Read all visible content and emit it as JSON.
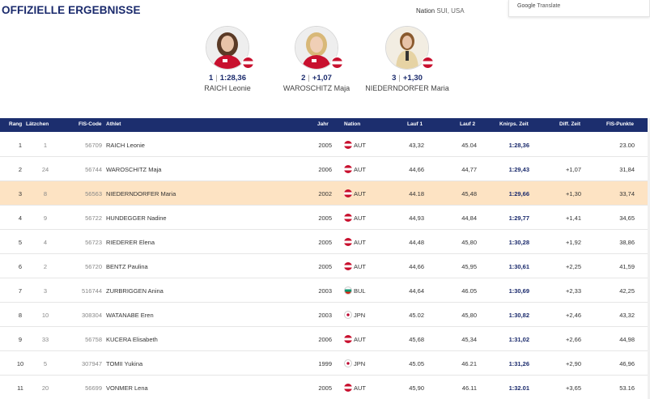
{
  "page": {
    "title": "OFFIZIELLE ERGEBNISSE"
  },
  "filter": {
    "label": "Nation",
    "value": "SUI, USA"
  },
  "translate": {
    "google": "Google",
    "label": "Translate"
  },
  "podium": [
    {
      "rank": "1",
      "time": "1:28,36",
      "name": "RAICH Leonie",
      "nation": "AUT"
    },
    {
      "rank": "2",
      "time": "+1,07",
      "name": "WAROSCHITZ Maja",
      "nation": "AUT"
    },
    {
      "rank": "3",
      "time": "+1,30",
      "name": "NIEDERNDORFER Maria",
      "nation": "AUT"
    }
  ],
  "table": {
    "headers": {
      "rang": "Rang",
      "latz": "Lätzchen",
      "fis": "FIS-Code",
      "athlet": "Athlet",
      "jahr": "Jahr",
      "nation": "Nation",
      "lauf1": "Lauf 1",
      "lauf2": "Lauf 2",
      "total": "Knirps. Zeit",
      "diff": "Diff. Zeit",
      "punkte": "FIS-Punkte"
    },
    "rows": [
      {
        "rang": "1",
        "latz": "1",
        "fis": "56709",
        "athlet": "RAICH Leonie",
        "jahr": "2005",
        "nation": "AUT",
        "lauf1": "43,32",
        "lauf2": "45.04",
        "total": "1:28,36",
        "diff": "",
        "punkte": "23.00"
      },
      {
        "rang": "2",
        "latz": "24",
        "fis": "56744",
        "athlet": "WAROSCHITZ Maja",
        "jahr": "2006",
        "nation": "AUT",
        "lauf1": "44,66",
        "lauf2": "44,77",
        "total": "1:29,43",
        "diff": "+1,07",
        "punkte": "31,84"
      },
      {
        "rang": "3",
        "latz": "8",
        "fis": "56563",
        "athlet": "NIEDERNDORFER Maria",
        "jahr": "2002",
        "nation": "AUT",
        "lauf1": "44.18",
        "lauf2": "45,48",
        "total": "1:29,66",
        "diff": "+1,30",
        "punkte": "33,74"
      },
      {
        "rang": "4",
        "latz": "9",
        "fis": "56722",
        "athlet": "HUNDEGGER Nadine",
        "jahr": "2005",
        "nation": "AUT",
        "lauf1": "44,93",
        "lauf2": "44,84",
        "total": "1:29,77",
        "diff": "+1,41",
        "punkte": "34,65"
      },
      {
        "rang": "5",
        "latz": "4",
        "fis": "56723",
        "athlet": "RIEDERER Elena",
        "jahr": "2005",
        "nation": "AUT",
        "lauf1": "44,48",
        "lauf2": "45,80",
        "total": "1:30,28",
        "diff": "+1,92",
        "punkte": "38,86"
      },
      {
        "rang": "6",
        "latz": "2",
        "fis": "56720",
        "athlet": "BENTZ Paulina",
        "jahr": "2005",
        "nation": "AUT",
        "lauf1": "44,66",
        "lauf2": "45,95",
        "total": "1:30,61",
        "diff": "+2,25",
        "punkte": "41,59"
      },
      {
        "rang": "7",
        "latz": "3",
        "fis": "516744",
        "athlet": "ZURBRIGGEN Anina",
        "jahr": "2003",
        "nation": "BUL",
        "lauf1": "44,64",
        "lauf2": "46.05",
        "total": "1:30,69",
        "diff": "+2,33",
        "punkte": "42,25"
      },
      {
        "rang": "8",
        "latz": "10",
        "fis": "308304",
        "athlet": "WATANABE Eren",
        "jahr": "2003",
        "nation": "JPN",
        "lauf1": "45.02",
        "lauf2": "45,80",
        "total": "1:30,82",
        "diff": "+2,46",
        "punkte": "43,32"
      },
      {
        "rang": "9",
        "latz": "33",
        "fis": "56758",
        "athlet": "KUCERA Elisabeth",
        "jahr": "2006",
        "nation": "AUT",
        "lauf1": "45,68",
        "lauf2": "45,34",
        "total": "1:31,02",
        "diff": "+2,66",
        "punkte": "44,98"
      },
      {
        "rang": "10",
        "latz": "5",
        "fis": "307947",
        "athlet": "TOMII Yukina",
        "jahr": "1999",
        "nation": "JPN",
        "lauf1": "45.05",
        "lauf2": "46.21",
        "total": "1:31,26",
        "diff": "+2,90",
        "punkte": "46,96"
      },
      {
        "rang": "11",
        "latz": "20",
        "fis": "56699",
        "athlet": "VONMER Lena",
        "jahr": "2005",
        "nation": "AUT",
        "lauf1": "45,90",
        "lauf2": "46.11",
        "total": "1:32.01",
        "diff": "+3,65",
        "punkte": "53.16"
      }
    ]
  },
  "colors": {
    "header_bg": "#1c2e6e",
    "title": "#1a2a6c",
    "highlight_row": "#fde3c3"
  },
  "highlighted_row": "3"
}
